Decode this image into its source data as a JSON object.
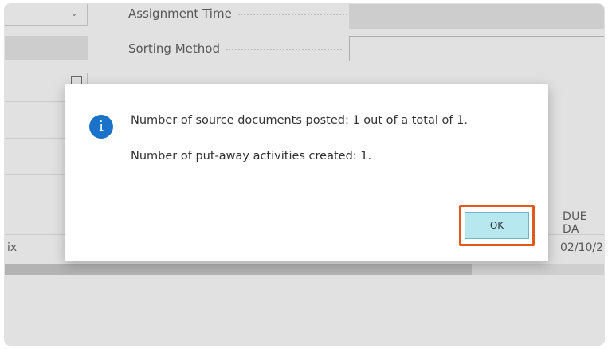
{
  "background": {
    "fields": [
      {
        "label": "Assignment Time"
      },
      {
        "label": "Sorting Method"
      }
    ],
    "columns": {
      "due_date_header": "DUE DA"
    },
    "row": {
      "left_cell": "ix",
      "right_fragment": ")",
      "due_date": "02/10/2"
    }
  },
  "dialog": {
    "icon": "info-icon",
    "message_line1": "Number of source documents posted: 1 out of a total of 1.",
    "message_line2": "Number of put-away activities created: 1.",
    "ok_label": "OK",
    "accent_color": "#1a73c8",
    "highlight_color": "#e05a1e"
  }
}
